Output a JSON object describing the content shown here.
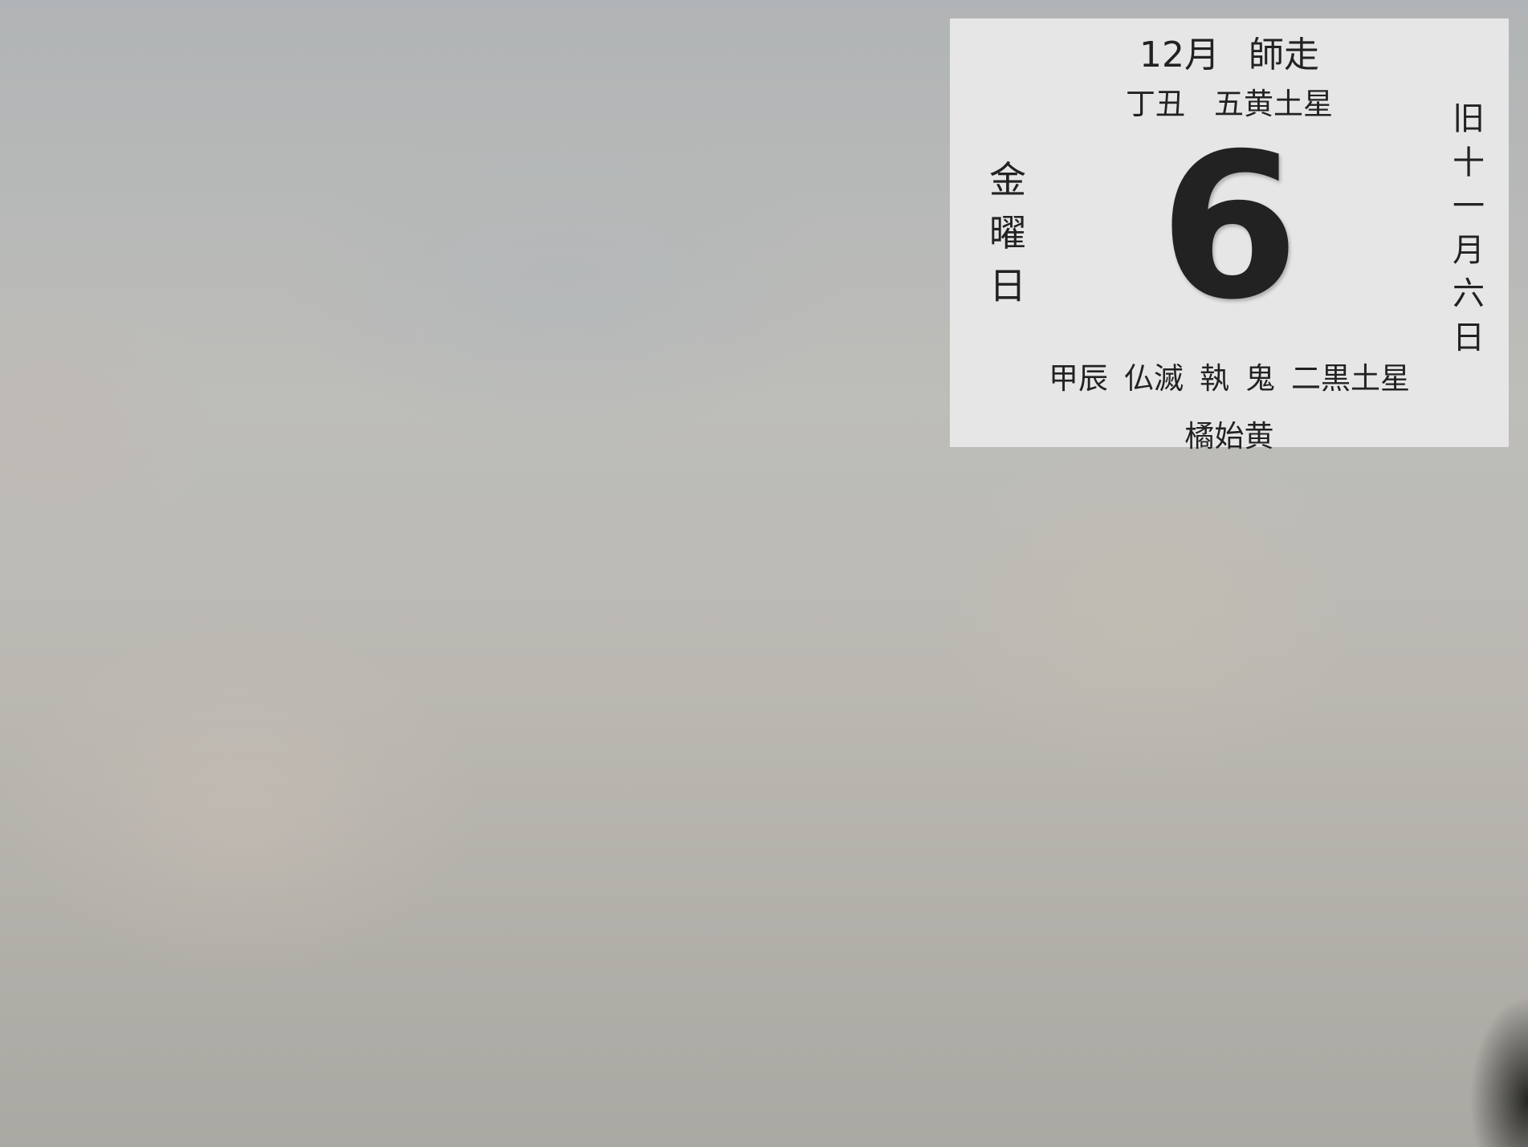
{
  "calendar_widget": {
    "month_label": "12月",
    "month_name": "師走",
    "year_stem_branch": "丁丑",
    "year_star": "五黄土星",
    "day_number": "6",
    "weekday_chars": [
      "金",
      "曜",
      "日"
    ],
    "lunar_date_chars": [
      "旧",
      "十",
      "一",
      "月",
      "六",
      "日"
    ],
    "day_stem_branch": "甲辰",
    "rokuyo": "仏滅",
    "choku": "執",
    "shuku": "鬼",
    "day_star": "二黒土星",
    "seasonal_phrase": "橘始黄"
  },
  "colors": {
    "widget_background": "#e6e6e6",
    "text": "#222222"
  }
}
